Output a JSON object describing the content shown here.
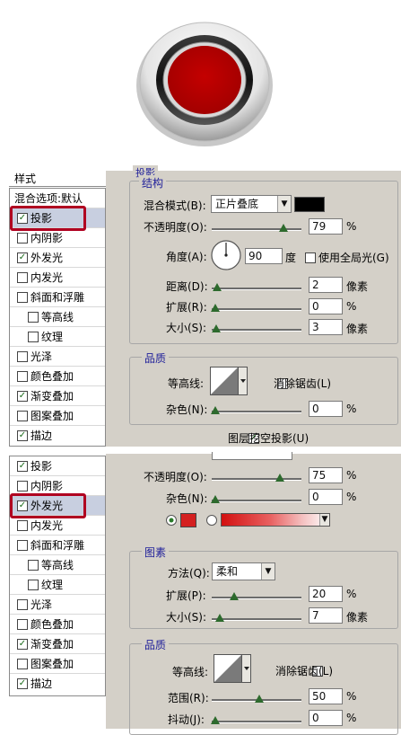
{
  "panel_top": {
    "left_header": "样式",
    "group_title": "投影",
    "section_title": "结构",
    "items": [
      {
        "label": "混合选项:默认",
        "checkbox": false,
        "checked": false,
        "sub": false
      },
      {
        "label": "投影",
        "checkbox": true,
        "checked": true,
        "sub": false
      },
      {
        "label": "内阴影",
        "checkbox": true,
        "checked": false,
        "sub": false
      },
      {
        "label": "外发光",
        "checkbox": true,
        "checked": true,
        "sub": false
      },
      {
        "label": "内发光",
        "checkbox": true,
        "checked": false,
        "sub": false
      },
      {
        "label": "斜面和浮雕",
        "checkbox": true,
        "checked": false,
        "sub": false
      },
      {
        "label": "等高线",
        "checkbox": true,
        "checked": false,
        "sub": true
      },
      {
        "label": "纹理",
        "checkbox": true,
        "checked": false,
        "sub": true
      },
      {
        "label": "光泽",
        "checkbox": true,
        "checked": false,
        "sub": false
      },
      {
        "label": "颜色叠加",
        "checkbox": true,
        "checked": false,
        "sub": false
      },
      {
        "label": "渐变叠加",
        "checkbox": true,
        "checked": true,
        "sub": false
      },
      {
        "label": "图案叠加",
        "checkbox": true,
        "checked": false,
        "sub": false
      },
      {
        "label": "描边",
        "checkbox": true,
        "checked": true,
        "sub": false
      }
    ],
    "blend_mode_label": "混合模式(B):",
    "blend_mode_value": "正片叠底",
    "opacity_label": "不透明度(O):",
    "opacity_value": "79",
    "opacity_fraction": 0.79,
    "angle_label": "角度(A):",
    "angle_value": "90",
    "angle_unit": "度",
    "global_light_label": "使用全局光(G)",
    "distance_label": "距离(D):",
    "distance_value": "2",
    "spread_label": "扩展(R):",
    "spread_value": "0",
    "size_label": "大小(S):",
    "size_value": "3",
    "unit_px": "像素",
    "unit_pct": "%",
    "quality_title": "品质",
    "contour_label": "等高线:",
    "antialias_label": "消除锯齿(L)",
    "noise_label": "杂色(N):",
    "noise_value": "0",
    "knockout_label": "图层挖空投影(U)"
  },
  "panel_bottom": {
    "items": [
      {
        "label": "投影",
        "checked": true,
        "sub": false
      },
      {
        "label": "内阴影",
        "checked": false,
        "sub": false
      },
      {
        "label": "外发光",
        "checked": true,
        "sub": false
      },
      {
        "label": "内发光",
        "checked": false,
        "sub": false
      },
      {
        "label": "斜面和浮雕",
        "checked": false,
        "sub": false
      },
      {
        "label": "等高线",
        "checked": false,
        "sub": true
      },
      {
        "label": "纹理",
        "checked": false,
        "sub": true
      },
      {
        "label": "光泽",
        "checked": false,
        "sub": false
      },
      {
        "label": "颜色叠加",
        "checked": false,
        "sub": false
      },
      {
        "label": "渐变叠加",
        "checked": true,
        "sub": false
      },
      {
        "label": "图案叠加",
        "checked": false,
        "sub": false
      },
      {
        "label": "描边",
        "checked": true,
        "sub": false
      }
    ],
    "opacity_label": "不透明度(O):",
    "opacity_value": "75",
    "opacity_fraction": 0.75,
    "noise_label": "杂色(N):",
    "noise_value": "0",
    "element_title": "图素",
    "method_label": "方法(Q):",
    "method_value": "柔和",
    "spread_label": "扩展(P):",
    "spread_value": "20",
    "size_label": "大小(S):",
    "size_value": "7",
    "unit_px": "像素",
    "unit_pct": "%",
    "quality_title": "品质",
    "contour_label": "等高线:",
    "antialias_label": "消除锯齿(L)",
    "range_label": "范围(R):",
    "range_value": "50",
    "jitter_label": "抖动(J):",
    "jitter_value": "0"
  },
  "colors": {
    "button_red": "#b00000",
    "glow_red": "#d42020",
    "highlight_box": "#b00020",
    "shadow_swatch": "#000000",
    "panel_bg": "#d4d0c8"
  }
}
